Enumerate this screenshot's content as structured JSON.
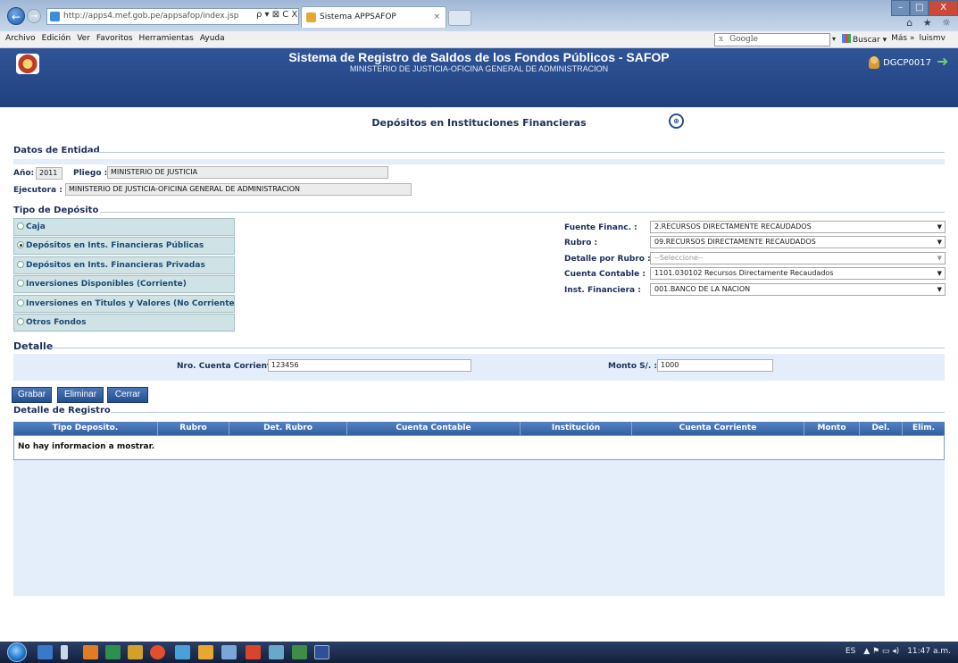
{
  "browser": {
    "url": "http://apps4.mef.gob.pe/appsafop/index.jsp",
    "address_controls": "ρ ▾ ⊠ C X",
    "tab_title": "Sistema APPSAFOP",
    "tab_close": "×",
    "window_min": "–",
    "window_max": "□",
    "window_close": "X",
    "toolbar_icons": "⌂ ★ ☼",
    "menu": [
      "Archivo",
      "Edición",
      "Ver",
      "Favoritos",
      "Herramientas",
      "Ayuda"
    ],
    "search_clear": "x",
    "search_placeholder": "Google",
    "search_dropdown": "▾",
    "buscar_label": "Buscar ▾",
    "mas_label": "Más »",
    "user_link": "luismv"
  },
  "header": {
    "title": "Sistema de Registro de Saldos de los Fondos Públicos - SAFOP",
    "subtitle": "MINISTERIO DE JUSTICIA-OFICINA GENERAL DE ADMINISTRACION",
    "user": "DGCP0017",
    "logout_icon": "➜"
  },
  "page": {
    "title": "Depósitos en Instituciones Financieras",
    "title_icon": "⊕"
  },
  "entidad": {
    "section": "Datos de Entidad",
    "anio_label": "Año:",
    "anio_value": "2011",
    "pliego_label": "Pliego :",
    "pliego_value": "MINISTERIO DE JUSTICIA",
    "ejecutora_label": "Ejecutora :",
    "ejecutora_value": "MINISTERIO DE JUSTICIA-OFICINA GENERAL DE ADMINISTRACION"
  },
  "tipo_deposito": {
    "section": "Tipo de Depósito",
    "options": [
      {
        "label": "Caja",
        "selected": false
      },
      {
        "label": "Depósitos en Ints. Financieras Públicas",
        "selected": true
      },
      {
        "label": "Depósitos en Ints. Financieras Privadas",
        "selected": false
      },
      {
        "label": "Inversiones Disponibles (Corriente)",
        "selected": false
      },
      {
        "label": "Inversiones en Titulos y Valores (No Corriente)",
        "selected": false
      },
      {
        "label": "Otros Fondos",
        "selected": false
      }
    ],
    "fields": {
      "fuente_label": "Fuente Financ. :",
      "fuente_value": "2.RECURSOS DIRECTAMENTE RECAUDADOS",
      "rubro_label": "Rubro :",
      "rubro_value": "09.RECURSOS DIRECTAMENTE RECAUDADOS",
      "detalle_label": "Detalle por Rubro :",
      "detalle_value": "--Seleccione--",
      "cuenta_label": "Cuenta Contable :",
      "cuenta_value": "1101.030102 Recursos Directamente Recaudados",
      "inst_label": "Inst. Financiera :",
      "inst_value": "001.BANCO DE LA NACION",
      "caret": "▼"
    }
  },
  "detalle": {
    "section": "Detalle",
    "cuenta_label": "Nro. Cuenta Corriente :",
    "cuenta_value": "123456",
    "monto_label": "Monto S/. :",
    "monto_value": "1000"
  },
  "buttons": {
    "grabar": "Grabar",
    "eliminar": "Eliminar",
    "cerrar": "Cerrar"
  },
  "registro": {
    "section": "Detalle de Registro",
    "columns": [
      "Tipo Deposito.",
      "Rubro",
      "Det. Rubro",
      "Cuenta Contable",
      "Institución",
      "Cuenta Corriente",
      "Monto",
      "Del.",
      "Elim."
    ],
    "empty_message": "No hay informacion a mostrar."
  },
  "taskbar": {
    "lang": "ES",
    "tray_icons": "▲ ⚑ ▭ ◂)",
    "time": "11:47 a.m."
  }
}
